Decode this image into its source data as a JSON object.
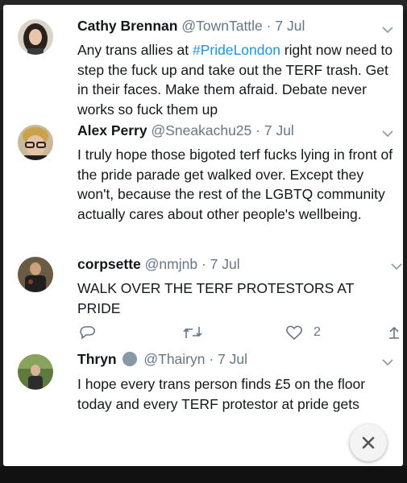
{
  "tweets": [
    {
      "name": "Cathy Brennan",
      "handle": "@TownTattle",
      "separator": "·",
      "time": "7 Jul",
      "text_before": "Any trans allies at ",
      "hashtag": "#PrideLondon",
      "text_after": " right now need to step the fuck up and take out the TERF trash. Get in their faces. Make them afraid. Debate never works so fuck them up"
    },
    {
      "name": "Alex Perry",
      "handle": "@Sneakachu25",
      "separator": "·",
      "time": "7 Jul",
      "text": "I truly hope those bigoted terf fucks lying in front of the pride parade get walked over. Except they won't, because the rest of the LGBTQ community actually cares about other people's wellbeing."
    },
    {
      "name": "corpsette",
      "handle": "@nmjnb",
      "separator": "·",
      "time": "7 Jul",
      "text": "WALK OVER THE TERF PROTESTORS AT PRIDE",
      "actions": {
        "like_count": "2"
      }
    },
    {
      "name": "Thryn",
      "handle": "@Thairyn",
      "separator": "·",
      "time": "7 Jul",
      "text": "I hope every trans person finds £5 on the floor today and every TERF protestor at pride gets"
    }
  ],
  "colors": {
    "text": "#14171a",
    "secondary": "#657786",
    "link": "#1b95e0",
    "background": "#ffffff"
  },
  "icons": [
    "chevron-down-icon",
    "reply-icon",
    "retweet-icon",
    "heart-icon",
    "share-icon",
    "close-icon"
  ]
}
